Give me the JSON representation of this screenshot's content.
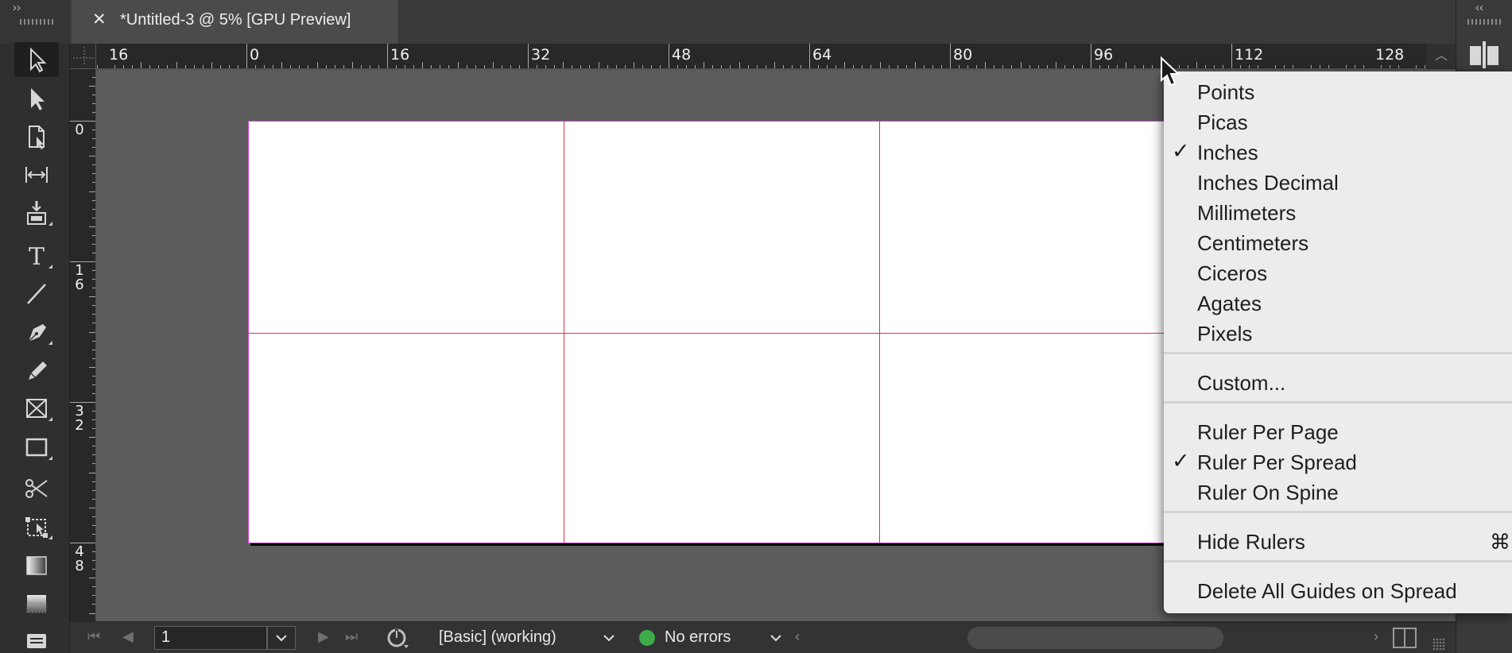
{
  "panel_controls": {
    "collapse_left": "››",
    "collapse_right": "‹‹"
  },
  "document_tab": {
    "close_glyph": "✕",
    "title": "*Untitled-3 @ 5% [GPU Preview]"
  },
  "tools": [
    {
      "name": "selection-tool",
      "icon": "arrow-outline-icon",
      "active": true
    },
    {
      "name": "direct-selection-tool",
      "icon": "arrow-filled-icon"
    },
    {
      "name": "page-tool",
      "icon": "page-icon"
    },
    {
      "name": "gap-tool",
      "icon": "gap-icon"
    },
    {
      "name": "content-collector-tool",
      "icon": "content-collector-icon"
    },
    {
      "name": "type-tool",
      "icon": "type-icon"
    },
    {
      "name": "line-tool",
      "icon": "line-icon"
    },
    {
      "name": "pen-tool",
      "icon": "pen-icon"
    },
    {
      "name": "pencil-tool",
      "icon": "pencil-icon"
    },
    {
      "name": "rectangle-frame-tool",
      "icon": "rectangle-frame-icon"
    },
    {
      "name": "rectangle-tool",
      "icon": "rectangle-icon"
    },
    {
      "name": "scissors-tool",
      "icon": "scissors-icon"
    },
    {
      "name": "free-transform-tool",
      "icon": "free-transform-icon"
    },
    {
      "name": "gradient-swatch-tool",
      "icon": "gradient-swatch-icon"
    },
    {
      "name": "gradient-feather-tool",
      "icon": "gradient-feather-icon"
    },
    {
      "name": "note-tool",
      "icon": "note-icon"
    }
  ],
  "horizontal_ruler": {
    "labels": [
      "16",
      "0",
      "16",
      "32",
      "48",
      "64",
      "80",
      "96",
      "112",
      "128"
    ]
  },
  "vertical_ruler": {
    "labels": [
      [
        "0"
      ],
      [
        "1",
        "6"
      ],
      [
        "3",
        "2"
      ],
      [
        "4",
        "8"
      ]
    ]
  },
  "context_menu": {
    "items": [
      {
        "label": "Points",
        "checked": false
      },
      {
        "label": "Picas",
        "checked": false
      },
      {
        "label": "Inches",
        "checked": true
      },
      {
        "label": "Inches Decimal",
        "checked": false
      },
      {
        "label": "Millimeters",
        "checked": false
      },
      {
        "label": "Centimeters",
        "checked": false
      },
      {
        "label": "Ciceros",
        "checked": false
      },
      {
        "label": "Agates",
        "checked": false
      },
      {
        "label": "Pixels",
        "checked": false
      },
      {
        "separator": true
      },
      {
        "label": "Custom...",
        "checked": false
      },
      {
        "separator": true
      },
      {
        "label": "Ruler Per Page",
        "checked": false
      },
      {
        "label": "Ruler Per Spread",
        "checked": true
      },
      {
        "label": "Ruler On Spine",
        "checked": false
      },
      {
        "separator": true
      },
      {
        "label": "Hide Rulers",
        "checked": false,
        "shortcut": "⌘R"
      },
      {
        "separator": true
      },
      {
        "label": "Delete All Guides on Spread",
        "checked": false
      }
    ],
    "check_glyph": "✓"
  },
  "status_bar": {
    "page_number": "1",
    "preflight_profile": "[Basic] (working)",
    "errors_text": "No errors",
    "status_color": "#3cab48"
  },
  "colors": {
    "page_border": "#d23bd2",
    "guide": "#e0304a",
    "pasteboard": "#5c5c5c"
  }
}
